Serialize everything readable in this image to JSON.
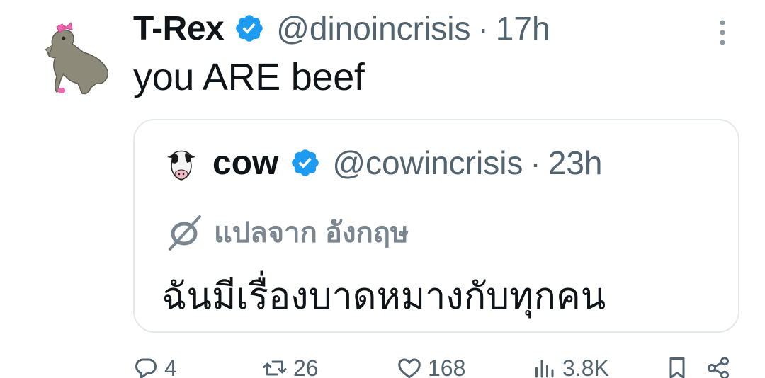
{
  "tweet": {
    "display_name": "T-Rex",
    "handle": "@dinoincrisis",
    "separator": "·",
    "time": "17h",
    "text": "you ARE beef"
  },
  "quoted_tweet": {
    "display_name": "cow",
    "handle": "@cowincrisis",
    "separator": "·",
    "time": "23h",
    "translate_label": "แปลจาก อังกฤษ",
    "text": "ฉันมีเรื่องบาดหมางกับทุกคน"
  },
  "actions": {
    "reply_count": "4",
    "retweet_count": "26",
    "like_count": "168",
    "views_count": "3.8K"
  },
  "icons": {
    "verified": "verified-badge-icon",
    "more": "more-vertical-icon",
    "reply": "reply-icon",
    "retweet": "retweet-icon",
    "like": "heart-icon",
    "views": "views-icon",
    "bookmark": "bookmark-icon",
    "share": "share-icon",
    "translate": "translate-icon"
  },
  "colors": {
    "verified_blue": "#1d9bf0",
    "secondary_text": "#536471",
    "border": "#e6e9ec"
  }
}
